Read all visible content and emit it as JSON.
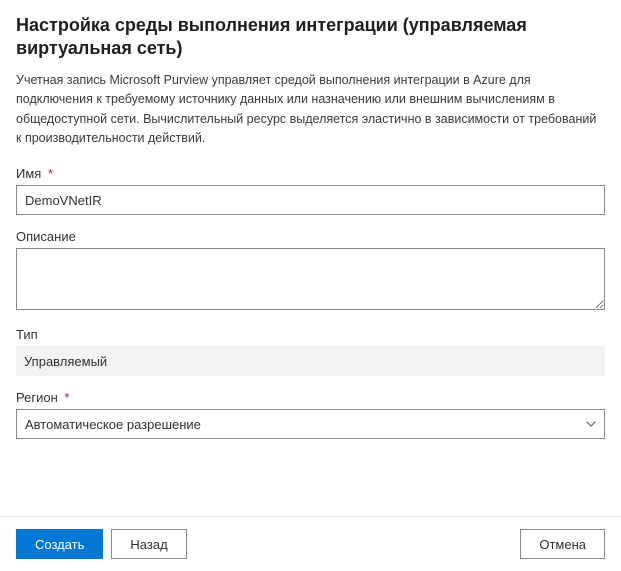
{
  "header": {
    "title": "Настройка среды выполнения интеграции (управляемая виртуальная сеть)",
    "description": "Учетная запись Microsoft Purview управляет средой выполнения интеграции в Azure для подключения к требуемому источнику данных или назначению или внешним вычислениям в общедоступной сети. Вычислительный ресурс выделяется эластично в зависимости от требований к производительности действий."
  },
  "form": {
    "name": {
      "label": "Имя",
      "required": "*",
      "value": "DemoVNetIR"
    },
    "description": {
      "label": "Описание",
      "value": ""
    },
    "type": {
      "label": "Тип",
      "value": "Управляемый"
    },
    "region": {
      "label": "Регион",
      "required": "*",
      "selected": "Автоматическое разрешение"
    }
  },
  "footer": {
    "create": "Создать",
    "back": "Назад",
    "cancel": "Отмена"
  }
}
